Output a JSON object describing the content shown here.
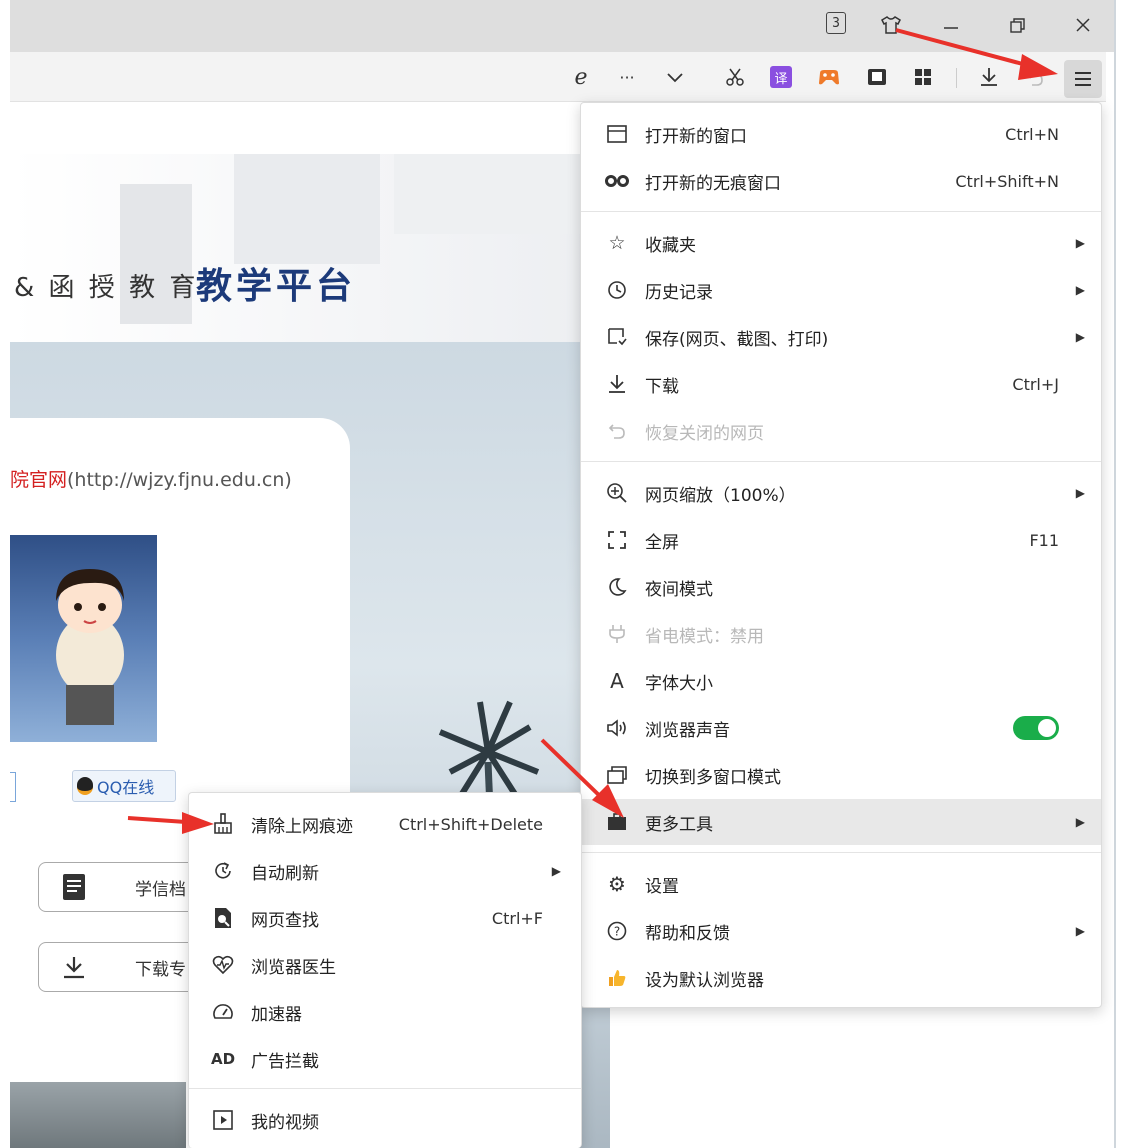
{
  "titlebar": {
    "tab_count": "3",
    "icons": [
      "skin-icon",
      "minimize-icon",
      "restore-icon",
      "close-icon"
    ]
  },
  "toolbar": {
    "icons": [
      "ie-compat-icon",
      "more-dots-icon",
      "chevron-down-icon",
      "scissors-icon",
      "translate-icon",
      "game-icon",
      "reader-icon",
      "apps-icon",
      "download-icon",
      "undo-icon",
      "menu-icon"
    ],
    "translate_label": "译"
  },
  "page": {
    "title_small": "& 函 授 教 育",
    "title_big": "教学平台",
    "official_prefix": "院官网",
    "official_url": "(http://wjzy.fjnu.edu.cn)",
    "qq_label": "QQ在线",
    "btn1": "学信档",
    "btn2": "下载专"
  },
  "main_menu": {
    "items": [
      {
        "label": "打开新的窗口",
        "shortcut": "Ctrl+N",
        "icon": "window-icon"
      },
      {
        "label": "打开新的无痕窗口",
        "shortcut": "Ctrl+Shift+N",
        "icon": "incognito-icon"
      },
      {
        "label": "收藏夹",
        "icon": "favorites-icon"
      },
      {
        "label": "历史记录",
        "icon": "history-icon"
      },
      {
        "label": "保存(网页、截图、打印)",
        "icon": "save-icon"
      },
      {
        "label": "下载",
        "shortcut": "Ctrl+J",
        "icon": "download-icon"
      },
      {
        "label": "恢复关闭的网页",
        "icon": "restore-page-icon"
      },
      {
        "label": "网页缩放（100%）",
        "icon": "zoom-icon"
      },
      {
        "label": "全屏",
        "shortcut": "F11",
        "icon": "fullscreen-icon"
      },
      {
        "label": "夜间模式",
        "icon": "moon-icon"
      },
      {
        "label": "省电模式：禁用",
        "icon": "power-plug-icon"
      },
      {
        "label": "字体大小",
        "icon": "font-icon"
      },
      {
        "label": "浏览器声音",
        "icon": "speaker-icon",
        "toggle_on": true
      },
      {
        "label": "切换到多窗口模式",
        "icon": "multi-window-icon"
      },
      {
        "label": "更多工具",
        "icon": "toolbox-icon"
      },
      {
        "label": "设置",
        "icon": "settings-icon"
      },
      {
        "label": "帮助和反馈",
        "icon": "help-icon"
      },
      {
        "label": "设为默认浏览器",
        "icon": "thumbs-up-icon"
      }
    ]
  },
  "sub_menu": {
    "items": [
      {
        "label": "清除上网痕迹",
        "shortcut": "Ctrl+Shift+Delete",
        "icon": "broom-icon"
      },
      {
        "label": "自动刷新",
        "icon": "auto-refresh-icon"
      },
      {
        "label": "网页查找",
        "shortcut": "Ctrl+F",
        "icon": "find-icon"
      },
      {
        "label": "浏览器医生",
        "icon": "doctor-icon"
      },
      {
        "label": "加速器",
        "icon": "speedometer-icon"
      },
      {
        "label": "广告拦截",
        "icon": "ad-block-icon",
        "icon_text": "AD"
      },
      {
        "label": "我的视频",
        "icon": "video-icon"
      }
    ]
  },
  "colors": {
    "annotation_arrow": "#e8312a",
    "toggle_on": "#1aad4a",
    "title_blue": "#1c3a7a",
    "link_red": "#d42020"
  }
}
